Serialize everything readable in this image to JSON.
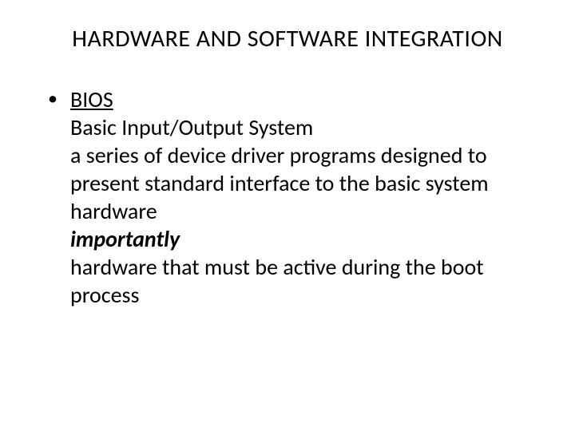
{
  "slide": {
    "title": "HARDWARE AND SOFTWARE INTEGRATION",
    "bullet": {
      "term": "BIOS",
      "line1": "Basic Input/Output System",
      "line2": "a series of device driver programs designed to present standard interface to the basic system hardware",
      "emph": "importantly",
      "line3": "hardware that must be active during the boot process"
    }
  }
}
